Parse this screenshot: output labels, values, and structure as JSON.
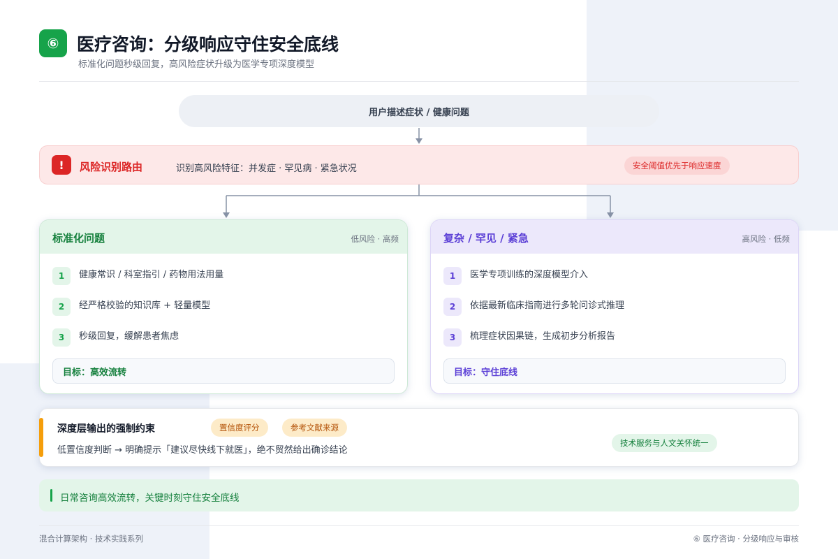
{
  "header": {
    "badge": "⑥",
    "title": "医疗咨询：分级响应守住安全底线",
    "subtitle": "标准化问题秒级回复，高风险症状升级为医学专项深度模型"
  },
  "input": {
    "label": "用户描述症状 / 健康问题"
  },
  "router": {
    "icon": "!",
    "title": "风险识别路由",
    "description": "识别高风险特征：并发症 · 罕见病 · 紧急状况",
    "tag": "安全阈值优先于响应速度"
  },
  "standard": {
    "title": "标准化问题",
    "meta": "低风险 · 高频",
    "steps": [
      {
        "num": "1",
        "text": "健康常识 / 科室指引 / 药物用法用量"
      },
      {
        "num": "2",
        "text": "经严格校验的知识库 + 轻量模型"
      },
      {
        "num": "3",
        "text": "秒级回复，缓解患者焦虑"
      }
    ],
    "goal": "目标：高效流转"
  },
  "complex": {
    "title": "复杂 / 罕见 / 紧急",
    "meta": "高风险 · 低频",
    "steps": [
      {
        "num": "1",
        "text": "医学专项训练的深度模型介入"
      },
      {
        "num": "2",
        "text": "依据最新临床指南进行多轮问诊式推理"
      },
      {
        "num": "3",
        "text": "梳理症状因果链，生成初步分析报告"
      }
    ],
    "goal": "目标：守住底线"
  },
  "constraint": {
    "title": "深度层输出的强制约束",
    "chips": [
      "置信度评分",
      "参考文献来源"
    ],
    "description": "低置信度判断 → 明确提示「建议尽快线下就医」，绝不贸然给出确诊结论",
    "tag": "技术服务与人文关怀统一"
  },
  "summary": {
    "text": "日常咨询高效流转，关键时刻守住安全底线"
  },
  "footer": {
    "left": "混合计算架构 · 技术实践系列",
    "right": "⑥ 医疗咨询 · 分级响应与审核"
  },
  "colors": {
    "green": "#16a34a",
    "red": "#dc2626",
    "purple": "#5b3fd6",
    "amber": "#f59e0b"
  }
}
